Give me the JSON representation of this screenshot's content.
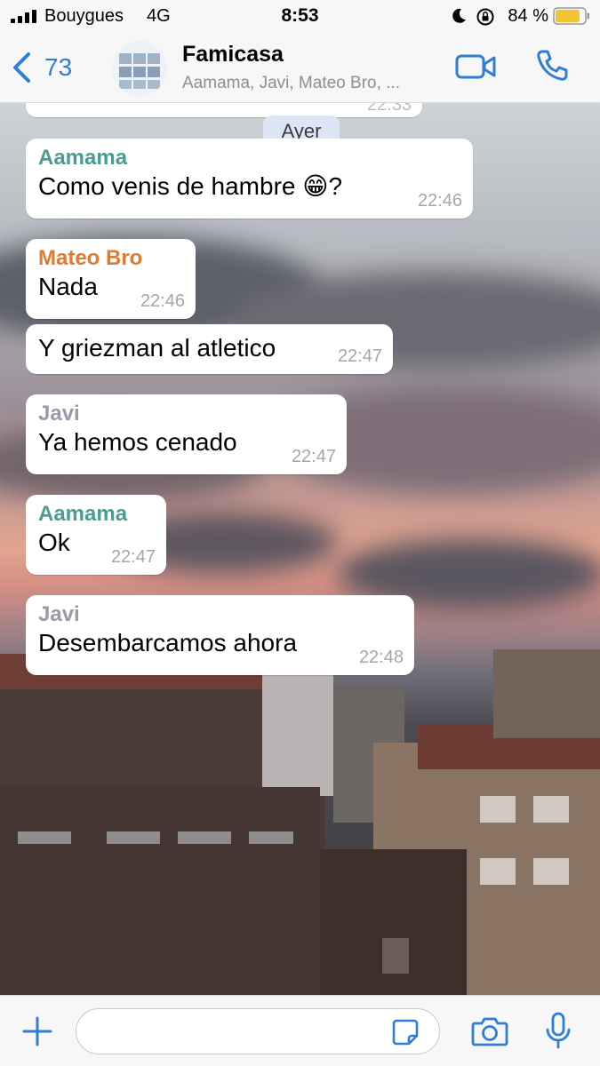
{
  "status_bar": {
    "carrier": "Bouygues",
    "network": "4G",
    "time": "8:53",
    "battery_percent": "84 %",
    "battery_level": 0.84,
    "icons": [
      "signal-icon",
      "moon-icon",
      "rotation-lock-icon",
      "battery-icon"
    ]
  },
  "header": {
    "back_count": "73",
    "title": "Famicasa",
    "subtitle": "Aamama, Javi, Mateo Bro, ...",
    "icons": [
      "back-chevron-icon",
      "group-avatar",
      "video-camera-icon",
      "phone-icon"
    ]
  },
  "chat": {
    "partial_top_timestamp": "22:33",
    "day_separator": "Ayer",
    "messages": [
      {
        "sender": "Aamama",
        "sender_color": "#4a9d8f",
        "text": "Como venis de hambre 😁?",
        "time": "22:46"
      },
      {
        "sender": "Mateo Bro",
        "sender_color": "#e07a2f",
        "text": "Nada",
        "time": "22:46"
      },
      {
        "sender": "",
        "text": "Y griezman al atletico",
        "time": "22:47"
      },
      {
        "sender": "Javi",
        "sender_color": "#9b9aa8",
        "text": "Ya hemos cenado",
        "time": "22:47"
      },
      {
        "sender": "Aamama",
        "sender_color": "#4a9d8f",
        "text": "Ok",
        "time": "22:47"
      },
      {
        "sender": "Javi",
        "sender_color": "#9b9aa8",
        "text": "Desembarcamos ahora",
        "time": "22:48"
      }
    ]
  },
  "input_bar": {
    "message_value": "",
    "icons": [
      "plus-icon",
      "sticker-icon",
      "camera-icon",
      "microphone-icon"
    ]
  },
  "colors": {
    "accent": "#2f7dd6",
    "bar_background": "#f7f7f7",
    "bubble_background": "#ffffff",
    "timestamp": "#a6a6a6"
  }
}
